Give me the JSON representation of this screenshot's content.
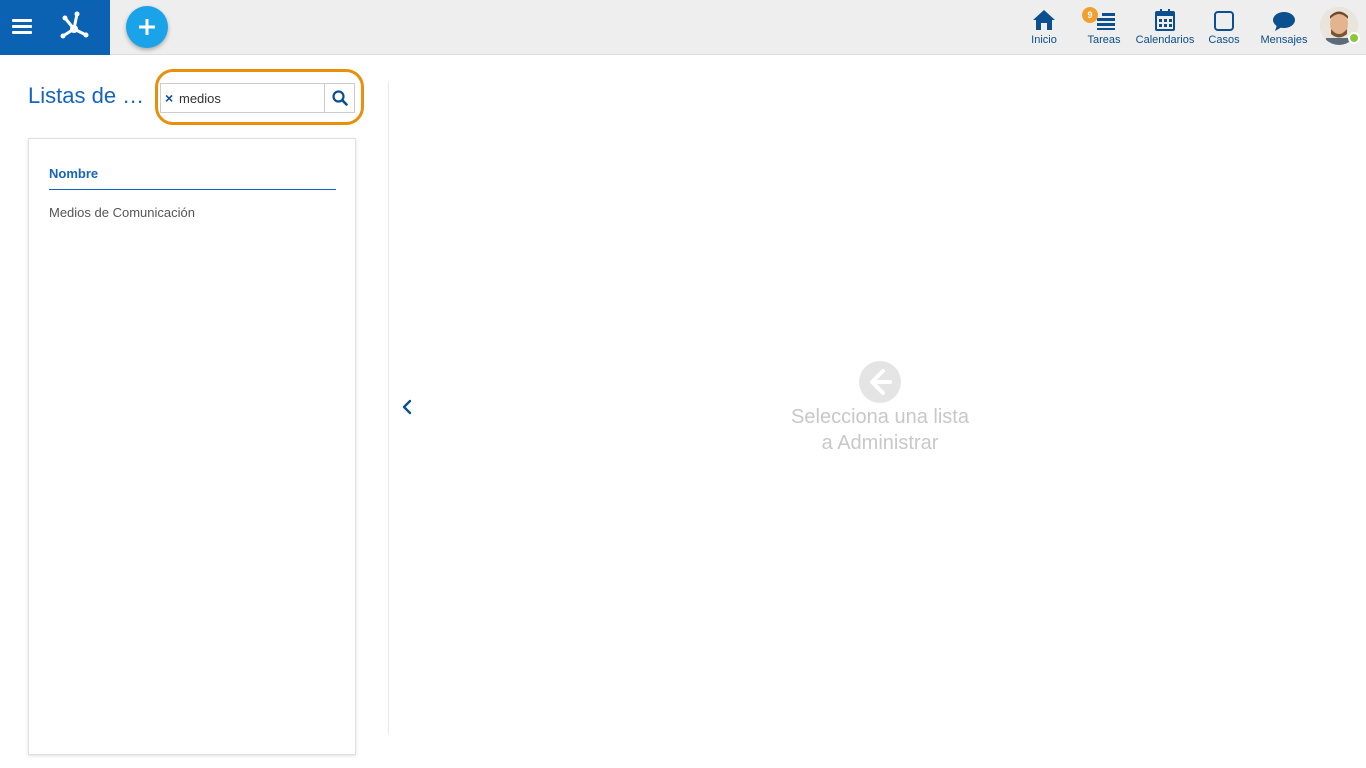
{
  "header": {
    "nav": [
      {
        "label": "Inicio",
        "icon": "home-icon"
      },
      {
        "label": "Tareas",
        "icon": "tasks-icon",
        "badge": "9"
      },
      {
        "label": "Calendarios",
        "icon": "calendar-icon"
      },
      {
        "label": "Casos",
        "icon": "cases-icon"
      },
      {
        "label": "Mensajes",
        "icon": "messages-icon"
      }
    ],
    "colors": {
      "brand": "#0b62b3",
      "add_button": "#1aa3e8",
      "badge": "#f0a030",
      "online": "#8cc63f"
    }
  },
  "left_panel": {
    "title": "Listas de …",
    "search": {
      "value": "medios"
    },
    "column_header": "Nombre",
    "rows": [
      {
        "name": "Medios de Comunicación"
      }
    ]
  },
  "main": {
    "empty_line1": "Selecciona una lista",
    "empty_line2": "a Administrar"
  }
}
